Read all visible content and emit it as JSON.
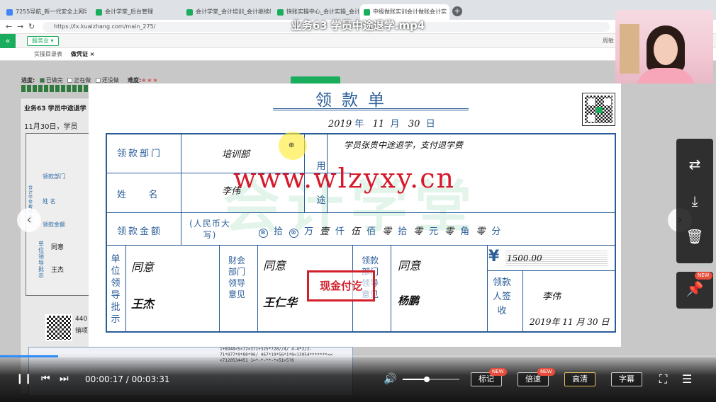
{
  "browser": {
    "tabs": [
      {
        "label": "7255导航_新一代安全上网导航",
        "active": false
      },
      {
        "label": "会计学堂_后台管理",
        "active": false
      },
      {
        "label": "会计学堂_会计培训_会计继续教",
        "active": false
      },
      {
        "label": "快账实操中心_会计实操_会计",
        "active": false
      },
      {
        "label": "中级做账实训会计做账会计实",
        "active": true
      }
    ],
    "url": "https://lx.kuaizhang.com/main_275/"
  },
  "app": {
    "industry_button": "服务业",
    "help_text": "周敏",
    "subtabs": [
      "实操目录表",
      "做凭证"
    ],
    "progress_label": "进度:",
    "legend": [
      "已做完",
      "正在做",
      "还没做"
    ],
    "difficulty_label": "难度:",
    "difficulty_stars": "★★★",
    "panel_title": "业务63 学员中途退学",
    "panel_text": "11月30日，学员",
    "mini_form": {
      "vertical": "会计学堂教学专用",
      "dept": "领款部门",
      "name": "姓 名",
      "amount": "领款金额",
      "approval": "单位领导批示",
      "agree": "同意",
      "signer": "王杰"
    },
    "invoice_code": "440",
    "invoice_label": "销项",
    "invoice_strip": "1+8948<5<72<371+325*720//4/ 4-4*2/2-71*877*9*88*96/ 467*19*56*1*8<13954*******<< <7120534451 1=*-*-**-*>51>5?6"
  },
  "voucher": {
    "title": "领款单",
    "date": {
      "year": "2019",
      "month": "11",
      "day": "30",
      "year_label": "年",
      "month_label": "月",
      "day_label": "日"
    },
    "labels": {
      "dept": "领款部门",
      "name": "姓    名",
      "amount": "领款金额",
      "rmb": "(人民币大写)",
      "purpose": "用途",
      "unit_leader": "单位领导批示",
      "finance_leader": "财会部门领导意见",
      "dept_leader": "领款部门领导意见",
      "receiver": "领款人签收"
    },
    "values": {
      "dept": "培训部",
      "name": "李伟",
      "purpose": "学员张贵中途退学，支付退学费",
      "unit_leader_opinion": "同意",
      "unit_leader_name": "王杰",
      "finance_opinion": "同意",
      "finance_name": "王仁华",
      "dept_opinion": "同意",
      "dept_name": "杨鹏",
      "amount_figure": "1500.00",
      "receiver_name": "李伟",
      "receiver_date": "2019年 11 月 30 日"
    },
    "amount_words": [
      {
        "t": "⊗",
        "k": "circ"
      },
      {
        "t": "拾",
        "k": "unit"
      },
      {
        "t": "⊗",
        "k": "circ"
      },
      {
        "t": "万",
        "k": "unit"
      },
      {
        "t": "壹",
        "k": "ink"
      },
      {
        "t": "仟",
        "k": "unit"
      },
      {
        "t": "伍",
        "k": "ink"
      },
      {
        "t": "佰",
        "k": "unit"
      },
      {
        "t": "零",
        "k": "ink"
      },
      {
        "t": "拾",
        "k": "unit"
      },
      {
        "t": "零",
        "k": "ink"
      },
      {
        "t": "元",
        "k": "unit"
      },
      {
        "t": "零",
        "k": "ink"
      },
      {
        "t": "角",
        "k": "unit"
      },
      {
        "t": "零",
        "k": "ink"
      },
      {
        "t": "分",
        "k": "unit"
      }
    ],
    "yen": "¥",
    "stamp": "现金付讫",
    "watermark": "www.wlzyxy.cn",
    "logo_watermark": "会计学堂"
  },
  "video": {
    "title": "业务63 学员中途退学.mp4",
    "current_time": "00:00:17",
    "total_time": "00:03:31",
    "progress": 0.081,
    "volume": 0.42,
    "buttons": {
      "mark": "标记",
      "speed": "倍速",
      "quality": "高清",
      "subtitle": "字幕"
    },
    "new_badge": "NEW"
  }
}
